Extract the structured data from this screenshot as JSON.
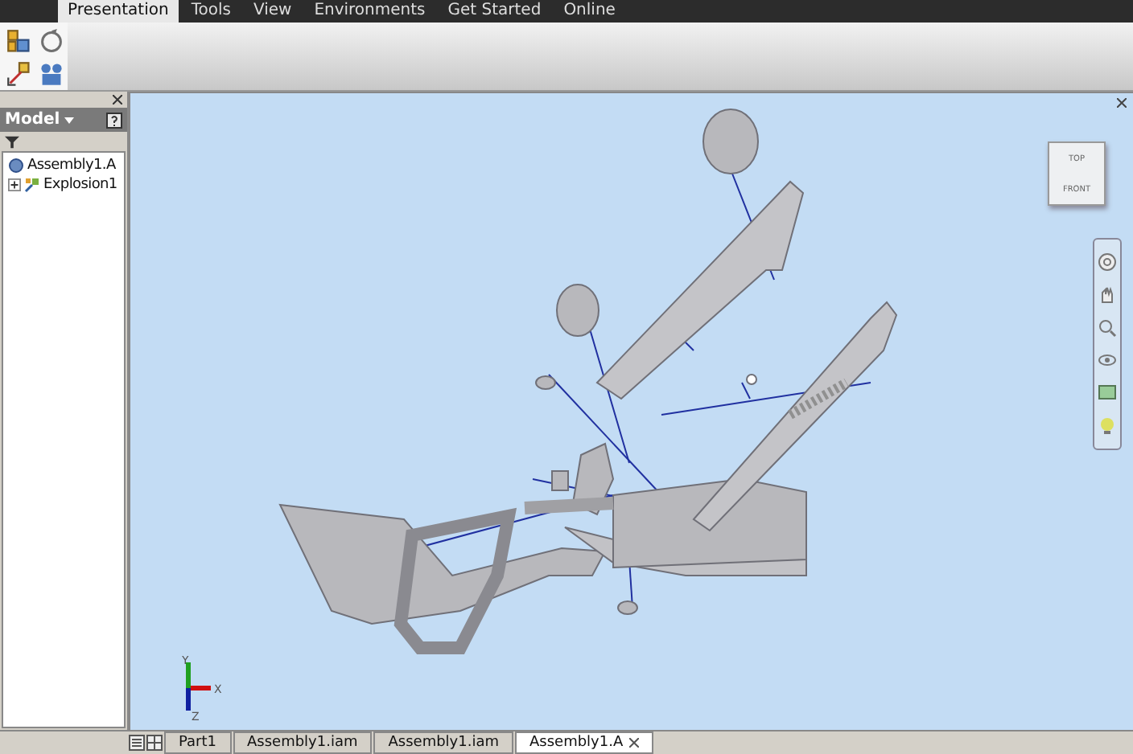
{
  "menu": [
    {
      "label": "Presentation",
      "selected": true
    },
    {
      "label": "Tools",
      "selected": false
    },
    {
      "label": "View",
      "selected": false
    },
    {
      "label": "Environments",
      "selected": false
    },
    {
      "label": "Get Started",
      "selected": false
    },
    {
      "label": "Online",
      "selected": false
    }
  ],
  "browser": {
    "title": "Model",
    "tree": [
      {
        "label": "Assembly1.A",
        "kind": "assembly",
        "children": [
          {
            "label": "Explosion1",
            "kind": "explosion"
          }
        ]
      }
    ]
  },
  "viewcube": {
    "top": "TOP",
    "front": "FRONT"
  },
  "axes": [
    {
      "label": "X",
      "color": "#d01010"
    },
    {
      "label": "Y",
      "color": "#20a020"
    },
    {
      "label": "Z",
      "color": "#1020a0"
    }
  ],
  "document_tabs": [
    {
      "label": "Part1",
      "selected": false
    },
    {
      "label": "Assembly1.iam",
      "selected": false
    },
    {
      "label": "Assembly1.iam",
      "selected": false
    },
    {
      "label": "Assembly1.A",
      "selected": true
    }
  ]
}
